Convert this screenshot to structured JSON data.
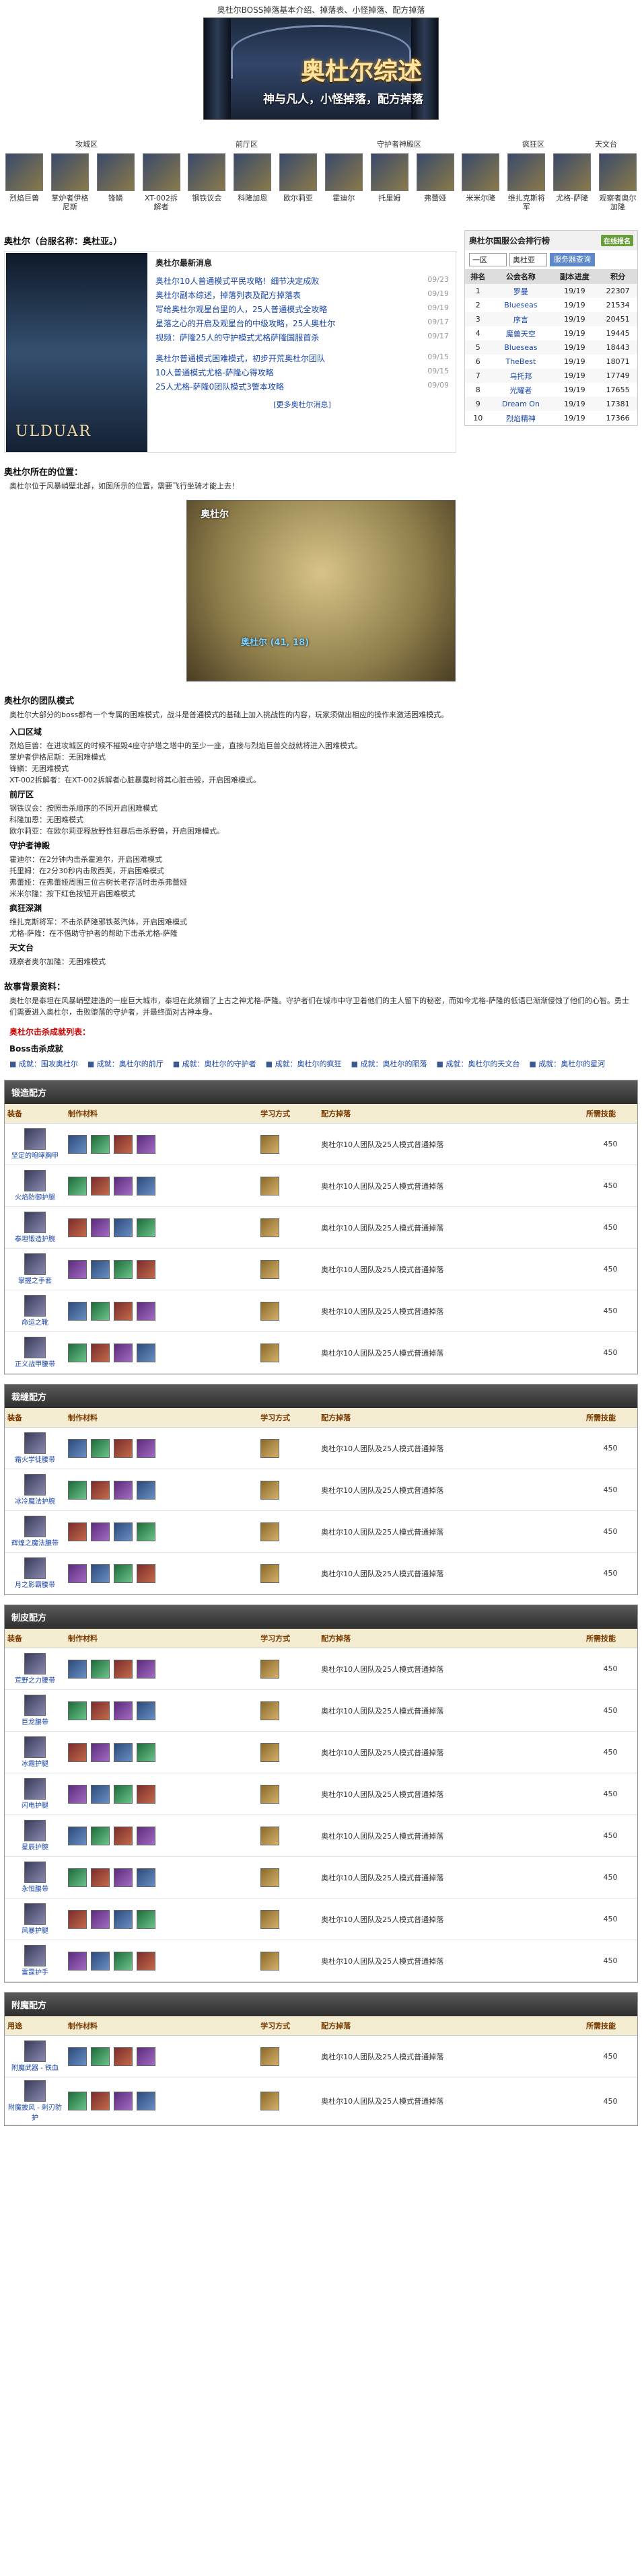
{
  "top_note": "奥杜尔BOSS掉落基本介绍、掉落表、小怪掉落、配方掉落",
  "banner": {
    "title": "奥杜尔综述",
    "sub": "神与凡人，小怪掉落，配方掉落"
  },
  "zones": [
    "攻城区",
    "前厅区",
    "守护者神殿区",
    "疯狂区",
    "天文台"
  ],
  "bosses": [
    "烈焰巨兽",
    "掌炉者伊格尼斯",
    "锋鳞",
    "XT-002拆解者",
    "钢铁议会",
    "科隆加恩",
    "欧尔莉亚",
    "霍迪尔",
    "托里姆",
    "弗蕾娅",
    "米米尔隆",
    "维扎克斯将军",
    "尤格-萨隆",
    "观察者奥尔加隆"
  ],
  "overview": {
    "title": "奥杜尔（台服名称：奥杜亚。）",
    "img_label": "ULDUAR"
  },
  "news": {
    "head": "奥杜尔最新消息",
    "items": [
      {
        "t": "奥杜尔10人普通模式平民攻略！细节决定成败",
        "d": "09/23"
      },
      {
        "t": "奥杜尔副本综述，掉落列表及配方掉落表",
        "d": "09/19"
      },
      {
        "t": "写给奥杜尔观星台里的人，25人普通模式全攻略",
        "d": "09/19"
      },
      {
        "t": "星落之心的开启及观星台的中级攻略，25人奥杜尔",
        "d": "09/17"
      },
      {
        "t": "视频：萨隆25人的守护模式尤格萨隆国服首杀",
        "d": "09/17"
      },
      {
        "t": "奥杜尔普通模式困难模式，初步开荒奥杜尔团队",
        "d": "09/15"
      },
      {
        "t": "10人普通模式尤格-萨隆心得攻略",
        "d": "09/15"
      },
      {
        "t": "25人尤格-萨隆0团队模式3警本攻略",
        "d": "09/09"
      }
    ],
    "more": "[更多奥杜尔消息]"
  },
  "guild": {
    "head": "奥杜尔国服公会排行榜",
    "btn": "在线报名",
    "sel": "一区",
    "sel2": "奥杜亚",
    "go": "服务器查询",
    "cols": [
      "排名",
      "公会名称",
      "副本进度",
      "积分"
    ],
    "rows": [
      [
        "1",
        "罗曼",
        "19/19",
        "22307"
      ],
      [
        "2",
        "Blueseas",
        "19/19",
        "21534"
      ],
      [
        "3",
        "序言",
        "19/19",
        "20451"
      ],
      [
        "4",
        "魔兽天空",
        "19/19",
        "19445"
      ],
      [
        "5",
        "Blueseas",
        "19/19",
        "18443"
      ],
      [
        "6",
        "TheBest",
        "19/19",
        "18071"
      ],
      [
        "7",
        "乌托邦",
        "19/19",
        "17749"
      ],
      [
        "8",
        "光耀者",
        "19/19",
        "17655"
      ],
      [
        "9",
        "Dream On",
        "19/19",
        "17381"
      ],
      [
        "10",
        "烈焰精神",
        "19/19",
        "17366"
      ]
    ]
  },
  "location": {
    "head": "奥杜尔所在的位置：",
    "text": "奥杜尔位于风暴峭壁北部，如图所示的位置，需要飞行坐骑才能上去！",
    "map_title": "奥杜尔",
    "map_coord": "奥杜尔 (41, 18)"
  },
  "instance": {
    "head": "奥杜尔的团队模式",
    "intro": "奥杜尔大部分的boss都有一个专属的困难模式，战斗是普通模式的基础上加入挑战性的内容，玩家须做出相应的操作来激活困难模式。",
    "entry_h": "入口区域",
    "entry": [
      "烈焰巨兽：在进攻城区的时候不摧毁4座守护塔之塔中的至少一座，直接与烈焰巨兽交战就将进入困难模式。",
      "掌炉者伊格尼斯：无困难模式",
      "锋鳞：无困难模式",
      "XT-002拆解者：在XT-002拆解者心脏暴露时将其心脏击毁，开启困难模式。"
    ],
    "hall_h": "前厅区",
    "hall": [
      "钢铁议会：按照击杀顺序的不同开启困难模式",
      "科隆加恩：无困难模式",
      "欧尔莉亚：在欧尔莉亚释放野性狂暴后击杀野兽，开启困难模式。"
    ],
    "keeper_h": "守护者神殿",
    "keeper": [
      "霍迪尔：在2分钟内击杀霍迪尔，开启困难模式",
      "托里姆：在2分30秒内击败西芙，开启困难模式",
      "弗蕾娅：在弗蕾娅周围三位古树长老存活时击杀弗蕾娅",
      "米米尔隆：按下红色按钮开启困难模式"
    ],
    "madness_h": "疯狂深渊",
    "madness": [
      "维扎克斯将军：不击杀萨隆邪铁蒸汽体，开启困难模式",
      "尤格-萨隆：在不借助守护者的帮助下击杀尤格-萨隆"
    ],
    "observatory_h": "天文台",
    "observatory": [
      "观察者奥尔加隆：无困难模式"
    ]
  },
  "story": {
    "head": "故事背景资料：",
    "text": "奥杜尔是泰坦在风暴峭壁建造的一座巨大城市，泰坦在此禁锢了上古之神尤格-萨隆。守护者们在城市中守卫着他们的主人留下的秘密，而如今尤格-萨隆的低语已渐渐侵蚀了他们的心智。勇士们需要进入奥杜尔，击败堕落的守护者，并最终面对古神本身。"
  },
  "achievements": {
    "head": "奥杜尔击杀成就列表：",
    "boss_h": "Boss击杀成就",
    "items": [
      "成就：围攻奥杜尔",
      "成就：奥杜尔的前厅",
      "成就：奥杜尔的守护者",
      "成就：奥杜尔的疯狂",
      "成就：奥杜尔的陨落",
      "成就：奥杜尔的天文台",
      "成就：奥杜尔的星河"
    ]
  },
  "crafts": [
    {
      "head": "锻造配方",
      "cols": [
        "装备",
        "制作材料",
        "学习方式",
        "配方掉落",
        "所需技能"
      ],
      "rows": [
        [
          "坚定的咆哮胸甲",
          "奥杜尔10人团队及25人模式普通掉落",
          "450"
        ],
        [
          "火焰防御护腿",
          "奥杜尔10人团队及25人模式普通掉落",
          "450"
        ],
        [
          "泰坦锻造护腕",
          "奥杜尔10人团队及25人模式普通掉落",
          "450"
        ],
        [
          "掌握之手套",
          "奥杜尔10人团队及25人模式普通掉落",
          "450"
        ],
        [
          "命运之靴",
          "奥杜尔10人团队及25人模式普通掉落",
          "450"
        ],
        [
          "正义战甲腰带",
          "奥杜尔10人团队及25人模式普通掉落",
          "450"
        ]
      ]
    },
    {
      "head": "裁缝配方",
      "cols": [
        "装备",
        "制作材料",
        "学习方式",
        "配方掉落",
        "所需技能"
      ],
      "rows": [
        [
          "霜火学徒腰带",
          "奥杜尔10人团队及25人模式普通掉落",
          "450"
        ],
        [
          "冰冷魔法护腕",
          "奥杜尔10人团队及25人模式普通掉落",
          "450"
        ],
        [
          "辉煌之魔法腰带",
          "奥杜尔10人团队及25人模式普通掉落",
          "450"
        ],
        [
          "月之影霸腰带",
          "奥杜尔10人团队及25人模式普通掉落",
          "450"
        ]
      ]
    },
    {
      "head": "制皮配方",
      "cols": [
        "装备",
        "制作材料",
        "学习方式",
        "配方掉落",
        "所需技能"
      ],
      "rows": [
        [
          "荒野之力腰带",
          "奥杜尔10人团队及25人模式普通掉落",
          "450"
        ],
        [
          "巨龙腰带",
          "奥杜尔10人团队及25人模式普通掉落",
          "450"
        ],
        [
          "冰霜护腿",
          "奥杜尔10人团队及25人模式普通掉落",
          "450"
        ],
        [
          "闪电护腿",
          "奥杜尔10人团队及25人模式普通掉落",
          "450"
        ],
        [
          "星辰护腕",
          "奥杜尔10人团队及25人模式普通掉落",
          "450"
        ],
        [
          "永恒腰带",
          "奥杜尔10人团队及25人模式普通掉落",
          "450"
        ],
        [
          "风暴护腿",
          "奥杜尔10人团队及25人模式普通掉落",
          "450"
        ],
        [
          "雷霆护手",
          "奥杜尔10人团队及25人模式普通掉落",
          "450"
        ]
      ]
    },
    {
      "head": "附魔配方",
      "cols": [
        "用途",
        "制作材料",
        "学习方式",
        "配方掉落",
        "所需技能"
      ],
      "rows": [
        [
          "附魔武器 - 铁血",
          "奥杜尔10人团队及25人模式普通掉落",
          "450"
        ],
        [
          "附魔披风 - 刺刃防护",
          "奥杜尔10人团队及25人模式普通掉落",
          "450"
        ]
      ]
    }
  ]
}
